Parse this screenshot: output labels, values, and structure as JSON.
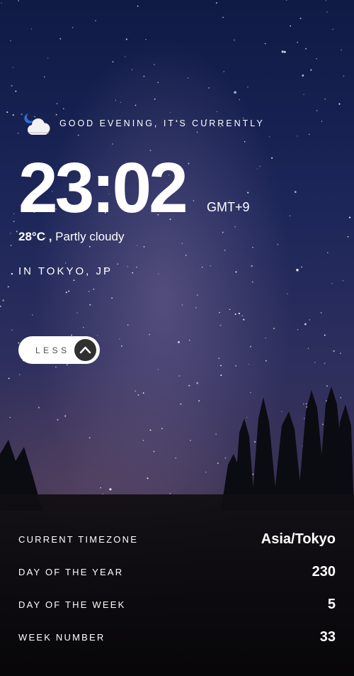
{
  "greeting": {
    "text": "GOOD EVENING, IT'S CURRENTLY",
    "icon": "moon-cloud-icon"
  },
  "clock": {
    "time": "23:02",
    "abbreviation": "GMT+9"
  },
  "weather": {
    "temperature": "28°C ,",
    "description": "Partly cloudy"
  },
  "location": "IN TOKYO, JP",
  "toggle": {
    "label": "LESS",
    "icon": "chevron-up-icon"
  },
  "details": {
    "rows": [
      {
        "label": "CURRENT TIMEZONE",
        "value": "Asia/Tokyo"
      },
      {
        "label": "DAY OF THE YEAR",
        "value": "230"
      },
      {
        "label": "DAY OF THE WEEK",
        "value": "5"
      },
      {
        "label": "WEEK NUMBER",
        "value": "33"
      }
    ]
  },
  "colors": {
    "panel_background": "#0b0a0c",
    "toggle_background": "#ffffff",
    "toggle_button": "#303030",
    "text": "#ffffff"
  }
}
